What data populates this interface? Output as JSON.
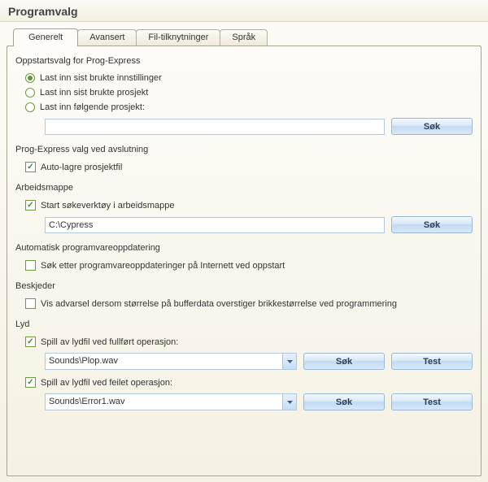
{
  "title": "Programvalg",
  "tabs": {
    "generelt": "Generelt",
    "avansert": "Avansert",
    "filtilknytninger": "Fil-tilknytninger",
    "sprak": "Språk"
  },
  "buttons": {
    "search": "Søk",
    "test": "Test"
  },
  "startup": {
    "legend": "Oppstartsvalg for Prog-Express",
    "opt_last_settings": "Last inn sist brukte innstillinger",
    "opt_last_project": "Last inn sist brukte prosjekt",
    "opt_following_project": "Last inn følgende prosjekt:",
    "project_path": ""
  },
  "shutdown": {
    "legend": "Prog-Express valg ved avslutning",
    "autosave": "Auto-lagre prosjektfil"
  },
  "workdir": {
    "legend": "Arbeidsmappe",
    "start_in_workdir": "Start søkeverktøy i arbeidsmappe",
    "path": "C:\\Cypress"
  },
  "update": {
    "legend": "Automatisk programvareoppdatering",
    "check_on_startup": "Søk etter programvareoppdateringer på Internett ved oppstart"
  },
  "messages": {
    "legend": "Beskjeder",
    "warn_buffer": "Vis advarsel dersom størrelse på bufferdata overstiger brikkestørrelse ved programmering"
  },
  "sound": {
    "legend": "Lyd",
    "play_success": "Spill av lydfil ved fullført operasjon:",
    "success_file": "Sounds\\Plop.wav",
    "play_fail": "Spill av lydfil ved feilet operasjon:",
    "fail_file": "Sounds\\Error1.wav"
  }
}
